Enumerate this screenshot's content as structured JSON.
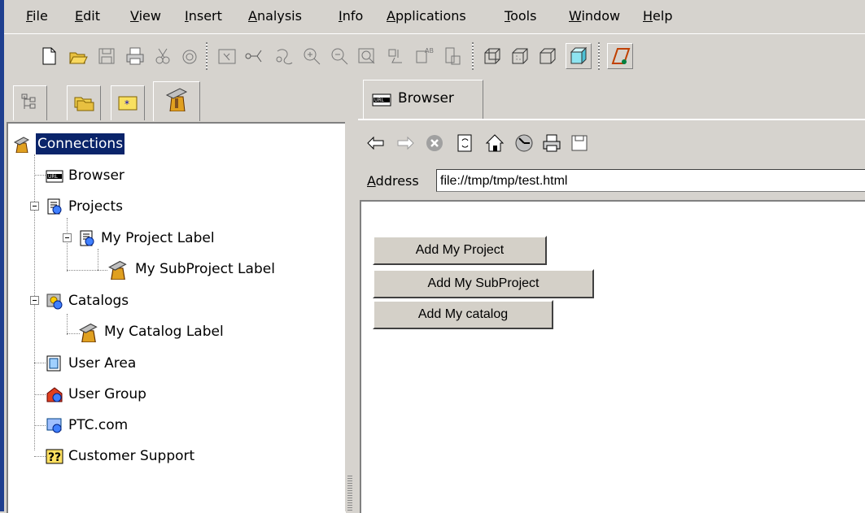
{
  "menubar": {
    "items": [
      {
        "first": "F",
        "rest": "ile"
      },
      {
        "first": "E",
        "rest": "dit"
      },
      {
        "first": "V",
        "rest": "iew"
      },
      {
        "first": "I",
        "rest": "nsert"
      },
      {
        "first": "A",
        "rest": "nalysis"
      },
      {
        "first": "I",
        "rest": "nfo"
      },
      {
        "first": "A",
        "rest": "pplications"
      },
      {
        "first": "T",
        "rest": "ools"
      },
      {
        "first": "W",
        "rest": "indow"
      },
      {
        "first": "H",
        "rest": "elp"
      }
    ]
  },
  "toolbar": {
    "icons": [
      "new-document-icon",
      "open-folder-icon",
      "save-icon",
      "print-icon",
      "cut-icon",
      "find-icon",
      "select-icon",
      "datum-axis-icon",
      "regenerate-icon",
      "zoom-in-icon",
      "zoom-out-icon",
      "refit-icon",
      "move-icon",
      "rename-icon",
      "layers-icon",
      "wireframe-icon",
      "hidden-line-icon",
      "no-hidden-icon",
      "shading-icon",
      "datum-plane-icon"
    ]
  },
  "left_tabs": [
    "model-tree-icon",
    "folder-browser-icon",
    "favorites-icon",
    "connections-icon"
  ],
  "tree": {
    "root": "Connections",
    "browser": "Browser",
    "projects": "Projects",
    "my_project": "My Project Label",
    "my_subproject": "My SubProject Label",
    "catalogs": "Catalogs",
    "my_catalog": "My Catalog Label",
    "user_area": "User Area",
    "user_group": "User Group",
    "ptc": "PTC.com",
    "support": "Customer Support"
  },
  "browser_tab": {
    "label": "Browser"
  },
  "navbar": {
    "icons": [
      "back-arrow-icon",
      "forward-arrow-icon",
      "stop-icon",
      "refresh-icon",
      "home-icon",
      "history-icon",
      "print-icon",
      "save-icon"
    ]
  },
  "address": {
    "label_first": "A",
    "label_rest": "ddress",
    "value": "file://tmp/tmp/test.html"
  },
  "page_buttons": {
    "add_project": "Add My Project",
    "add_subproject": "Add My SubProject",
    "add_catalog": "Add My catalog"
  }
}
